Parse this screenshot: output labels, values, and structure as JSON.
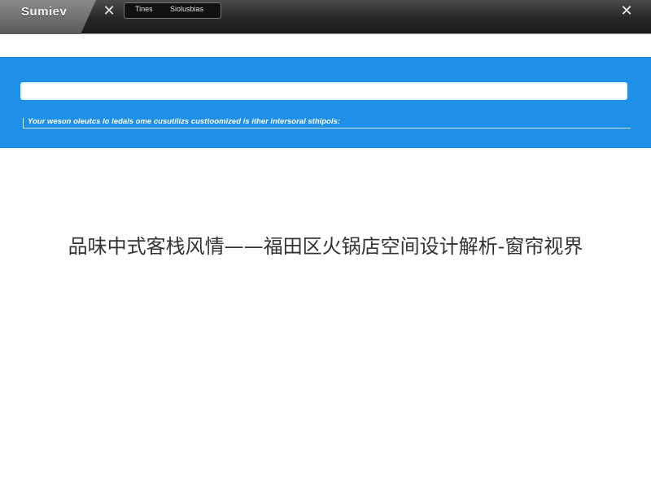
{
  "window": {
    "logo_text": "Sumiev",
    "close_icon": "close-icon",
    "tabs": [
      {
        "label": "Tines"
      },
      {
        "label": "Siolusbias"
      }
    ]
  },
  "banner": {
    "color": "#1f90e8",
    "search": {
      "value": "",
      "placeholder": ""
    },
    "hint": "Your weson oleutcs lo ledals ome cusutilizs custtoomized is ither intersoral sthipols:"
  },
  "main": {
    "headline": "品味中式客栈风情——福田区火锅店空间设计解析-窗帘视界"
  }
}
